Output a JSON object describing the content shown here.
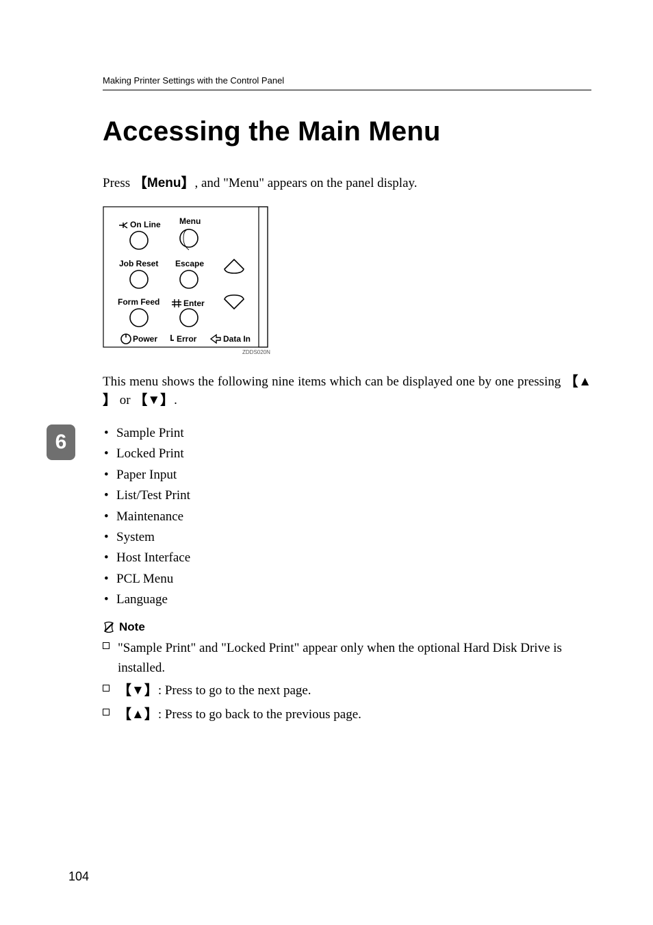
{
  "header": {
    "section_title": "Making Printer Settings with the Control Panel"
  },
  "title": "Accessing the Main Menu",
  "intro": {
    "pre": "Press ",
    "key_open": "【",
    "key_label": "Menu",
    "key_close": "】",
    "post": ", and \"Menu\" appears on the panel display."
  },
  "diagram": {
    "labels": {
      "on_line": "On Line",
      "menu": "Menu",
      "job_reset": "Job Reset",
      "escape": "Escape",
      "form_feed": "Form Feed",
      "enter": "Enter",
      "power": "Power",
      "error": "Error",
      "data_in": "Data In"
    },
    "caption": "ZDDS020N"
  },
  "middle_paragraph": {
    "text_a": "This menu shows the following nine items which can be displayed one by one pressing ",
    "up_open": "【",
    "up_arrow": "▲",
    "up_close": "】",
    "or": " or ",
    "down_open": "【",
    "down_arrow": "▼",
    "down_close": "】",
    "period": "."
  },
  "bullets": [
    "Sample Print",
    "Locked Print",
    "Paper Input",
    "List/Test Print",
    "Maintenance",
    "System",
    "Host Interface",
    "PCL Menu",
    "Language"
  ],
  "note_label": "Note",
  "notes": {
    "item1": "\"Sample Print\" and \"Locked Print\" appear only when the optional Hard Disk Drive is installed.",
    "item2": {
      "open": "【",
      "arrow": "▼",
      "close": "】",
      "text": ": Press to go to the next page."
    },
    "item3": {
      "open": "【",
      "arrow": "▲",
      "close": "】",
      "text": ": Press to go back to the previous page."
    }
  },
  "side_tab": "6",
  "page_number": "104"
}
